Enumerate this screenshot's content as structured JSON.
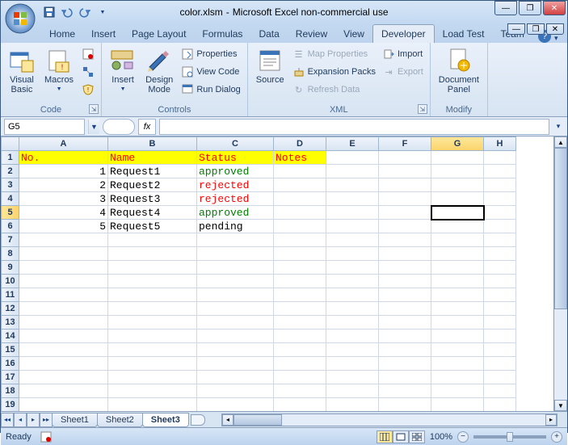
{
  "window": {
    "title_doc": "color.xlsm",
    "title_app": "Microsoft Excel non-commercial use"
  },
  "tabs": {
    "home": "Home",
    "insert": "Insert",
    "page_layout": "Page Layout",
    "formulas": "Formulas",
    "data": "Data",
    "review": "Review",
    "view": "View",
    "developer": "Developer",
    "load_test": "Load Test",
    "team": "Team"
  },
  "ribbon": {
    "code": {
      "group": "Code",
      "visual_basic": "Visual\nBasic",
      "macros": "Macros"
    },
    "controls": {
      "group": "Controls",
      "insert": "Insert",
      "design_mode": "Design\nMode",
      "properties": "Properties",
      "view_code": "View Code",
      "run_dialog": "Run Dialog"
    },
    "xml": {
      "group": "XML",
      "source": "Source",
      "map_properties": "Map Properties",
      "expansion_packs": "Expansion Packs",
      "refresh_data": "Refresh Data",
      "import": "Import",
      "export": "Export"
    },
    "modify": {
      "group": "Modify",
      "document_panel": "Document\nPanel"
    }
  },
  "name_box": "G5",
  "formula_value": "",
  "columns": [
    "A",
    "B",
    "C",
    "D",
    "E",
    "F",
    "G",
    "H"
  ],
  "row_count": 19,
  "active_cell": {
    "row": 5,
    "col": "G"
  },
  "header_row": {
    "A": "No.",
    "B": "Name",
    "C": "Status",
    "D": "Notes"
  },
  "data_rows": [
    {
      "no": "1",
      "name": "Request1",
      "status": "approved",
      "status_class": "green"
    },
    {
      "no": "2",
      "name": "Request2",
      "status": "rejected",
      "status_class": "red"
    },
    {
      "no": "3",
      "name": "Request3",
      "status": "rejected",
      "status_class": "red"
    },
    {
      "no": "4",
      "name": "Request4",
      "status": "approved",
      "status_class": "green"
    },
    {
      "no": "5",
      "name": "Request5",
      "status": "pending",
      "status_class": ""
    }
  ],
  "sheets": [
    "Sheet1",
    "Sheet2",
    "Sheet3"
  ],
  "active_sheet": "Sheet3",
  "status": {
    "ready": "Ready",
    "zoom": "100%"
  }
}
